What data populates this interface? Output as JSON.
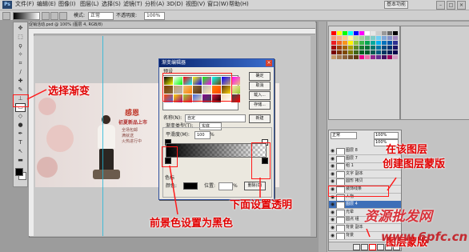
{
  "app": {
    "logo": "Ps",
    "menu": [
      "文件(F)",
      "编辑(E)",
      "图像(I)",
      "图层(L)",
      "选择(S)",
      "滤镜(T)",
      "分析(A)",
      "3D(D)",
      "视图(V)",
      "窗口(W)",
      "帮助(H)"
    ],
    "workspace_button": "基本功能"
  },
  "options": {
    "mode_label": "模式:",
    "mode_value": "正常",
    "opacity_label": "不透明度:",
    "opacity_value": "100%"
  },
  "document": {
    "tab_title": "促销活动.psd @ 100% (图层 4, RGB/8)"
  },
  "banner": {
    "headline": "感恩",
    "subline": "初夏新品上市",
    "body_lines": [
      "全场包邮",
      "满就送",
      "火热进行中"
    ]
  },
  "gradient_dialog": {
    "title": "渐变编辑器",
    "presets_label": "预设",
    "buttons": [
      "确定",
      "取消",
      "载入...",
      "存储..."
    ],
    "new_button": "新建",
    "name_label": "名称(N):",
    "name_value": "自定",
    "type_label": "渐变类型(T):",
    "type_value": "实底",
    "smooth_label": "平滑度(M):",
    "smooth_value": "100",
    "smooth_unit": "%",
    "stops_label": "色标",
    "color_label": "颜色:",
    "location_label": "位置:",
    "location_unit": "%",
    "delete_button": "删除(D)"
  },
  "layers": {
    "blend_mode": "正常",
    "opacity": "100%",
    "fill": "100%",
    "rows": [
      "图层 8",
      "图层 7",
      "组 1",
      "文字 副本",
      "圆形 拷贝",
      "装饰线条",
      "人物",
      "图层 4",
      "光晕",
      "圆点 组",
      "背景 副本",
      "背景"
    ],
    "selected_index": 7
  },
  "swatches": {
    "colors": [
      "#ff0000",
      "#ffff00",
      "#00ff00",
      "#00ffff",
      "#0000ff",
      "#ff00ff",
      "#ffffff",
      "#e6e6e6",
      "#cccccc",
      "#999999",
      "#666666",
      "#000000",
      "#f7977a",
      "#f9ad81",
      "#fdc68a",
      "#fff79a",
      "#c4df9b",
      "#a2d39c",
      "#82ca9d",
      "#7bcdc8",
      "#6ecff6",
      "#7ea7d8",
      "#8493ca",
      "#a187be",
      "#ed1c24",
      "#f26522",
      "#f7941d",
      "#fff200",
      "#8dc63f",
      "#39b54a",
      "#00a651",
      "#00a99d",
      "#00aeef",
      "#0072bc",
      "#0054a6",
      "#2e3192",
      "#9e0b0f",
      "#a0410d",
      "#a36209",
      "#aba000",
      "#598527",
      "#1a7b30",
      "#007236",
      "#00746b",
      "#0076a3",
      "#004b80",
      "#003471",
      "#1b1464",
      "#790000",
      "#7b2e00",
      "#7d4900",
      "#827b00",
      "#406618",
      "#005e20",
      "#005826",
      "#005952",
      "#005b7f",
      "#003663",
      "#002157",
      "#0d004c",
      "#c69c6d",
      "#a67c52",
      "#8c6239",
      "#754c24",
      "#603913",
      "#ec008c",
      "#f06eaa",
      "#92278f",
      "#662d91",
      "#440e62",
      "#9e005d",
      "#d3a0c3"
    ]
  },
  "preset_colors": [
    "#000000",
    "#ffffff",
    "#ff0000",
    "#ffff00",
    "#00ff00",
    "#00ffff",
    "#0000ff",
    "#ff00ff",
    "#7a3e00",
    "#c9a36b",
    "#e8c27a",
    "#8a6d3b",
    "#b5b5b5",
    "#ff7f00",
    "#5c3317",
    "#ffe4b5",
    "#ff4500",
    "#ffd700",
    "#9acd32",
    "#4169e1",
    "#8b008b",
    "#dc143c",
    "#f5deb3",
    "#2f4f4f"
  ],
  "annotations": {
    "select_gradient": "选择渐变",
    "set_transparent_below": "下面设置透明",
    "foreground_black": "前景色设置为黑色",
    "create_mask_line1": "在该图层",
    "create_mask_line2": "创建图层蒙版",
    "layer_mask_label": "图层蒙版"
  },
  "watermark": {
    "line1": "资源批发网",
    "line2": "www.6pfc.cn"
  }
}
